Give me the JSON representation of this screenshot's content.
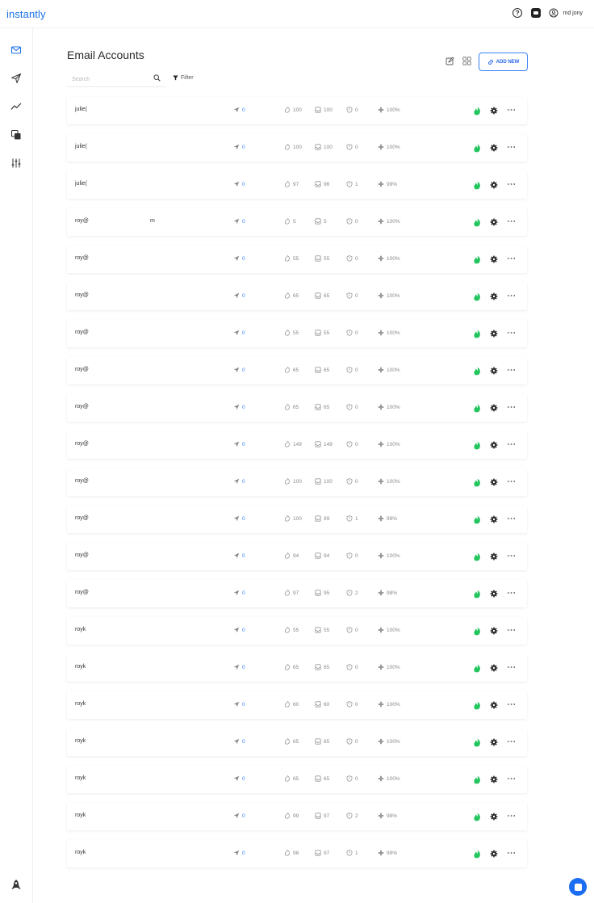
{
  "app": {
    "logo": "instantly"
  },
  "header": {
    "user_name": "md jony"
  },
  "page": {
    "title": "Email Accounts"
  },
  "search": {
    "placeholder": "Search"
  },
  "filter": {
    "label": "Filter"
  },
  "toolbar": {
    "add_new_label": "ADD NEW"
  },
  "accounts": [
    {
      "email": "julie(",
      "sent": "0",
      "s1": "100",
      "s2": "100",
      "s3": "0",
      "health": "100%"
    },
    {
      "email": "julie(",
      "sent": "0",
      "s1": "100",
      "s2": "100",
      "s3": "0",
      "health": "100%"
    },
    {
      "email": "julie(",
      "sent": "0",
      "s1": "97",
      "s2": "96",
      "s3": "1",
      "health": "99%"
    },
    {
      "email": "roy@",
      "tail": "m",
      "sent": "0",
      "s1": "5",
      "s2": "5",
      "s3": "0",
      "health": "100%"
    },
    {
      "email": "roy@",
      "sent": "0",
      "s1": "55",
      "s2": "55",
      "s3": "0",
      "health": "100%"
    },
    {
      "email": "roy@",
      "sent": "0",
      "s1": "65",
      "s2": "65",
      "s3": "0",
      "health": "100%"
    },
    {
      "email": "roy@",
      "sent": "0",
      "s1": "55",
      "s2": "55",
      "s3": "0",
      "health": "100%"
    },
    {
      "email": "roy@",
      "sent": "0",
      "s1": "65",
      "s2": "65",
      "s3": "0",
      "health": "100%"
    },
    {
      "email": "roy@",
      "sent": "0",
      "s1": "65",
      "s2": "65",
      "s3": "0",
      "health": "100%"
    },
    {
      "email": "roy@",
      "sent": "0",
      "s1": "149",
      "s2": "149",
      "s3": "0",
      "health": "100%"
    },
    {
      "email": "roy@",
      "sent": "0",
      "s1": "100",
      "s2": "100",
      "s3": "0",
      "health": "100%"
    },
    {
      "email": "roy@",
      "sent": "0",
      "s1": "100",
      "s2": "99",
      "s3": "1",
      "health": "99%"
    },
    {
      "email": "roy@",
      "sent": "0",
      "s1": "94",
      "s2": "94",
      "s3": "0",
      "health": "100%"
    },
    {
      "email": "roy@",
      "sent": "0",
      "s1": "97",
      "s2": "95",
      "s3": "2",
      "health": "98%"
    },
    {
      "email": "royk",
      "sent": "0",
      "s1": "55",
      "s2": "55",
      "s3": "0",
      "health": "100%"
    },
    {
      "email": "royk",
      "sent": "0",
      "s1": "65",
      "s2": "65",
      "s3": "0",
      "health": "100%"
    },
    {
      "email": "royk",
      "sent": "0",
      "s1": "60",
      "s2": "60",
      "s3": "0",
      "health": "100%"
    },
    {
      "email": "royk",
      "sent": "0",
      "s1": "65",
      "s2": "65",
      "s3": "0",
      "health": "100%"
    },
    {
      "email": "royk",
      "sent": "0",
      "s1": "65",
      "s2": "65",
      "s3": "0",
      "health": "100%"
    },
    {
      "email": "royk",
      "sent": "0",
      "s1": "99",
      "s2": "97",
      "s3": "2",
      "health": "98%"
    },
    {
      "email": "royk",
      "sent": "0",
      "s1": "98",
      "s2": "97",
      "s3": "1",
      "health": "99%"
    }
  ],
  "colors": {
    "accent": "#1a73e8",
    "flame": "#22c55e",
    "sent": "#3b82f6"
  }
}
